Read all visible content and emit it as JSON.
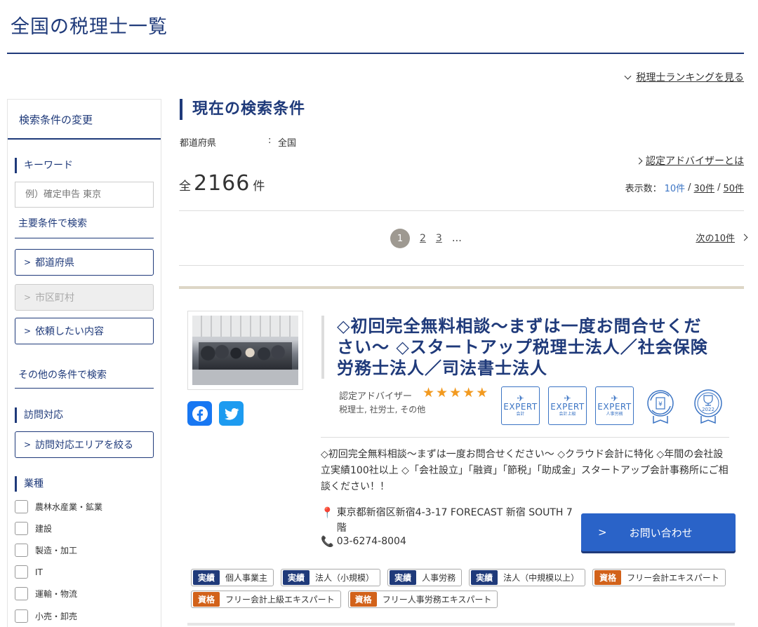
{
  "page": {
    "title": "全国の税理士一覧",
    "ranking_link": "税理士ランキングを見る"
  },
  "sidebar": {
    "header": "検索条件の変更",
    "keyword_label": "キーワード",
    "keyword_placeholder": "例）確定申告 東京",
    "main_conditions": "主要条件で検索",
    "prefecture_button": "都道府県",
    "city_button": "市区町村",
    "request_button": "依頼したい内容",
    "other_conditions": "その他の条件で検索",
    "visit_label": "訪問対応",
    "visit_button": "訪問対応エリアを絞る",
    "industry_label": "業種",
    "industries": [
      "農林水産業・鉱業",
      "建設",
      "製造・加工",
      "IT",
      "運輸・物流",
      "小売・卸売"
    ]
  },
  "conditions": {
    "title": "現在の検索条件",
    "pref_key": "都道府県",
    "sep": ":",
    "pref_value": "全国",
    "advisor_link": "認定アドバイザーとは",
    "total_prefix": "全",
    "total_count": "2166",
    "total_suffix": "件",
    "per_page_label": "表示数：",
    "per_page_current": "10件",
    "per_page_30": "30件",
    "per_page_50": "50件",
    "slash": "/"
  },
  "pagination": {
    "pages": [
      "1",
      "2",
      "3"
    ],
    "ellipsis": "…",
    "next": "次の10件"
  },
  "listing": {
    "title": "◇初回完全無料相談〜まずは一度お問合せください〜 ◇スタートアップ税理士法人／社会保険労務士法人／司法書士法人",
    "advisor_label": "認定アドバイザー",
    "rating": 5,
    "qualifications": "税理士, 社労士, その他",
    "badges": [
      {
        "label": "EXPERT",
        "sub": "会計"
      },
      {
        "label": "EXPERT",
        "sub": "会計上級"
      },
      {
        "label": "EXPERT",
        "sub": "人事労務"
      }
    ],
    "award_year": "2022",
    "description": "◇初回完全無料相談〜まずは一度お問合せください〜 ◇クラウド会計に特化 ◇年間の会社設立実績100社以上 ◇「会社設立」「融資」「節税」「助成金」スタートアップ会計事務所にご相談ください！！",
    "address": "東京都新宿区新宿4-3-17 FORECAST 新宿 SOUTH 7 階",
    "phone": "03-6274-8004",
    "contact_button": "お問い合わせ",
    "tags": [
      {
        "kind": "実績",
        "label": "個人事業主",
        "color": "#1f3a7a"
      },
      {
        "kind": "実績",
        "label": "法人（小規模）",
        "color": "#1f3a7a"
      },
      {
        "kind": "実績",
        "label": "人事労務",
        "color": "#1f3a7a"
      },
      {
        "kind": "実績",
        "label": "法人（中規模以上）",
        "color": "#1f3a7a"
      },
      {
        "kind": "資格",
        "label": "フリー会計エキスパート",
        "color": "#d2621a"
      },
      {
        "kind": "資格",
        "label": "フリー会計上級エキスパート",
        "color": "#d2621a"
      },
      {
        "kind": "資格",
        "label": "フリー人事労務エキスパート",
        "color": "#d2621a"
      }
    ]
  },
  "colors": {
    "brand_navy": "#1f3a7a",
    "link_blue": "#3b74c4",
    "button_blue": "#2a63c8",
    "star_orange": "#f29a20",
    "tag_orange": "#d2621a"
  }
}
